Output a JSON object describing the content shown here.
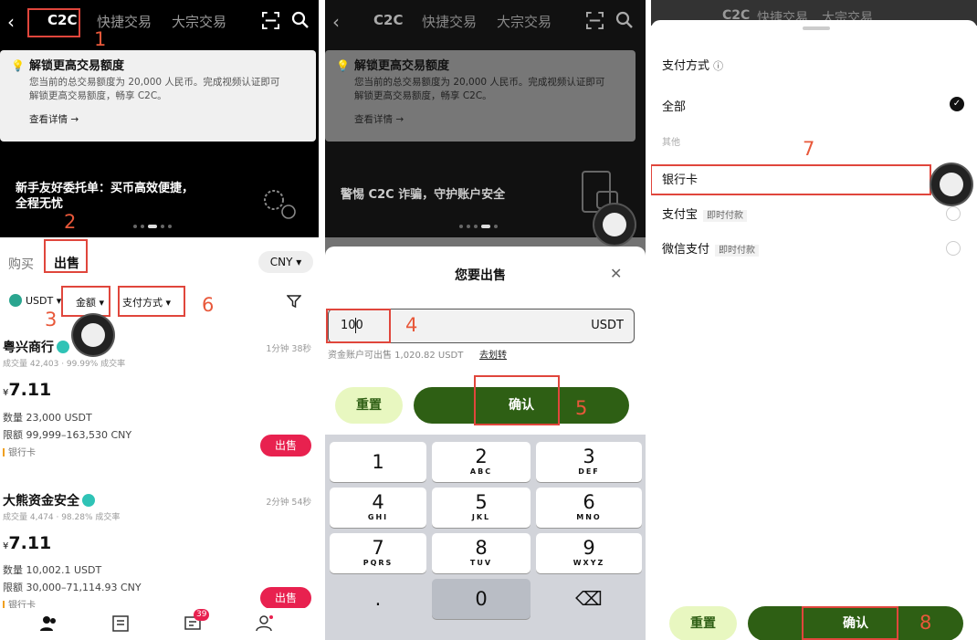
{
  "header": {
    "back_icon": "‹",
    "tab_c2c": "C2C",
    "tab_quick": "快捷交易",
    "tab_bulk": "大宗交易"
  },
  "notice": {
    "title": "解锁更高交易额度",
    "desc_line1": "您当前的总交易额度为 20,000 人民币。完成视频认证即可",
    "desc_line2": "解锁更高交易额度，畅享 C2C。",
    "link": "查看详情 →"
  },
  "promo1": {
    "line1": "新手友好委托单：买币高效便捷，",
    "line2": "全程无忧"
  },
  "promo2": {
    "text": "警惕 C2C 诈骗，守护账户安全"
  },
  "side_tabs": {
    "buy": "购买",
    "sell": "出售"
  },
  "currency": "CNY ▾",
  "filters": {
    "coin": "USDT ▾",
    "amount": "金额 ▾",
    "payment": "支付方式 ▾"
  },
  "trades": [
    {
      "merchant": "粤兴商行",
      "stats": "成交量 42,403 · 99.99% 成交率",
      "time": "1分钟 38秒",
      "price_symbol": "¥",
      "price": "7.11",
      "quantity": "数量 23,000 USDT",
      "limit": "限额 99,999–163,530 CNY",
      "payment": "银行卡",
      "action": "出售"
    },
    {
      "merchant": "大熊资金安全",
      "stats": "成交量 4,474 · 98.28% 成交率",
      "time": "2分钟 54秒",
      "price_symbol": "¥",
      "price": "7.11",
      "quantity": "数量 10,002.1 USDT",
      "limit": "限额 30,000–71,114.93 CNY",
      "payment": "银行卡",
      "action": "出售"
    }
  ],
  "nav": {
    "badge": "39"
  },
  "sell_sheet": {
    "title": "您要出售",
    "close_icon": "✕",
    "amount_value": "100",
    "unit": "USDT",
    "available": "资金账户可出售 1,020.82 USDT",
    "transfer": "去划转",
    "reset": "重置",
    "confirm": "确认"
  },
  "keypad": [
    {
      "n": "1",
      "s": ""
    },
    {
      "n": "2",
      "s": "ABC"
    },
    {
      "n": "3",
      "s": "DEF"
    },
    {
      "n": "4",
      "s": "GHI"
    },
    {
      "n": "5",
      "s": "JKL"
    },
    {
      "n": "6",
      "s": "MNO"
    },
    {
      "n": "7",
      "s": "PQRS"
    },
    {
      "n": "8",
      "s": "TUV"
    },
    {
      "n": "9",
      "s": "WXYZ"
    },
    {
      "n": ".",
      "s": ""
    },
    {
      "n": "0",
      "s": ""
    },
    {
      "n": "⌫",
      "s": ""
    }
  ],
  "payment_sheet": {
    "title": "支付方式",
    "info_icon": "ⓘ",
    "all": "全部",
    "other": "其他",
    "bank": "银行卡",
    "alipay": "支付宝",
    "alipay_tag": "即时付款",
    "wechat": "微信支付",
    "wechat_tag": "即时付款",
    "reset": "重置",
    "confirm": "确认"
  },
  "steps": [
    "1",
    "2",
    "3",
    "4",
    "5",
    "6",
    "7",
    "8"
  ],
  "colors": {
    "accent": "#2e5f14",
    "sell": "#e8214f",
    "light_green": "#e8f7c0",
    "annotation": "#e0463c"
  }
}
